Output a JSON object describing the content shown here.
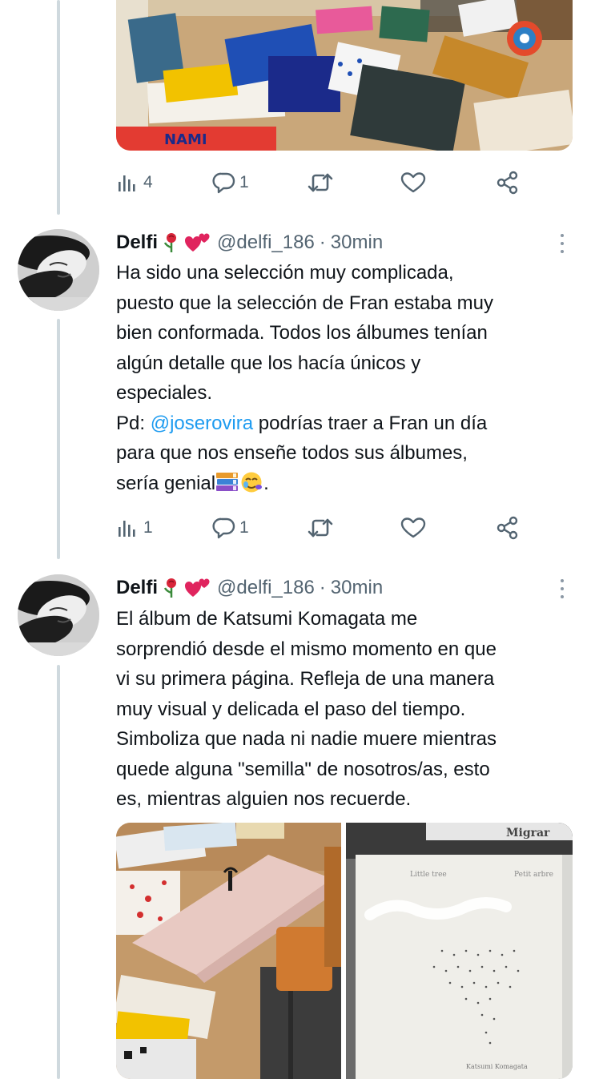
{
  "top_tweet": {
    "image_alt": "photo-of-picture-books-on-table",
    "image_text": "NAMI",
    "stats": {
      "views": "4",
      "replies": "1"
    }
  },
  "tweet1": {
    "author": "Delfi",
    "emojis": [
      "rose",
      "two-hearts"
    ],
    "handle": "@delfi_186",
    "separator": "·",
    "time": "30min",
    "lines": [
      "Ha sido una selección muy complicada,",
      "puesto que la selección de Fran estaba muy",
      "bien conformada. Todos los álbumes tenían",
      "algún detalle que los hacía únicos y",
      "especiales."
    ],
    "pd_prefix": "Pd: ",
    "mention": "@joserovira",
    "pd_rest": " podrías traer a Fran un día",
    "pd_line2": "para que nos enseñe todos sus álbumes,",
    "pd_line3": "sería genial",
    "pd_end": ".",
    "pd_emojis": [
      "books",
      "face-holding-back-tears"
    ],
    "stats": {
      "views": "1",
      "replies": "1"
    }
  },
  "tweet2": {
    "author": "Delfi",
    "emojis": [
      "rose",
      "two-hearts"
    ],
    "handle": "@delfi_186",
    "separator": "·",
    "time": "30min",
    "lines": [
      "El álbum de Katsumi Komagata me",
      "sorprendió desde el mismo momento en que",
      "vi su primera página. Refleja de una manera",
      "muy visual y delicada el paso del tiempo.",
      "Simboliza que nada ni nadie muere mientras",
      "quede alguna \"semilla\" de nosotros/as, esto",
      "es, mientras alguien nos recuerde."
    ],
    "image1_alt": "pop-up-book-tree-on-table",
    "image2_alt": "book-cover-little-tree",
    "image2_texts": {
      "top_book": "Migrar",
      "title_left": "Little tree",
      "title_right": "Petit arbre",
      "author": "Katsumi Komagata"
    }
  },
  "icons": [
    "views-icon",
    "reply-icon",
    "retweet-icon",
    "like-icon",
    "share-icon",
    "more-icon"
  ],
  "colors": {
    "text": "#0f1419",
    "secondary": "#536471",
    "link": "#1d9bf0",
    "thread_line": "#cfd9de",
    "background": "#ffffff"
  }
}
